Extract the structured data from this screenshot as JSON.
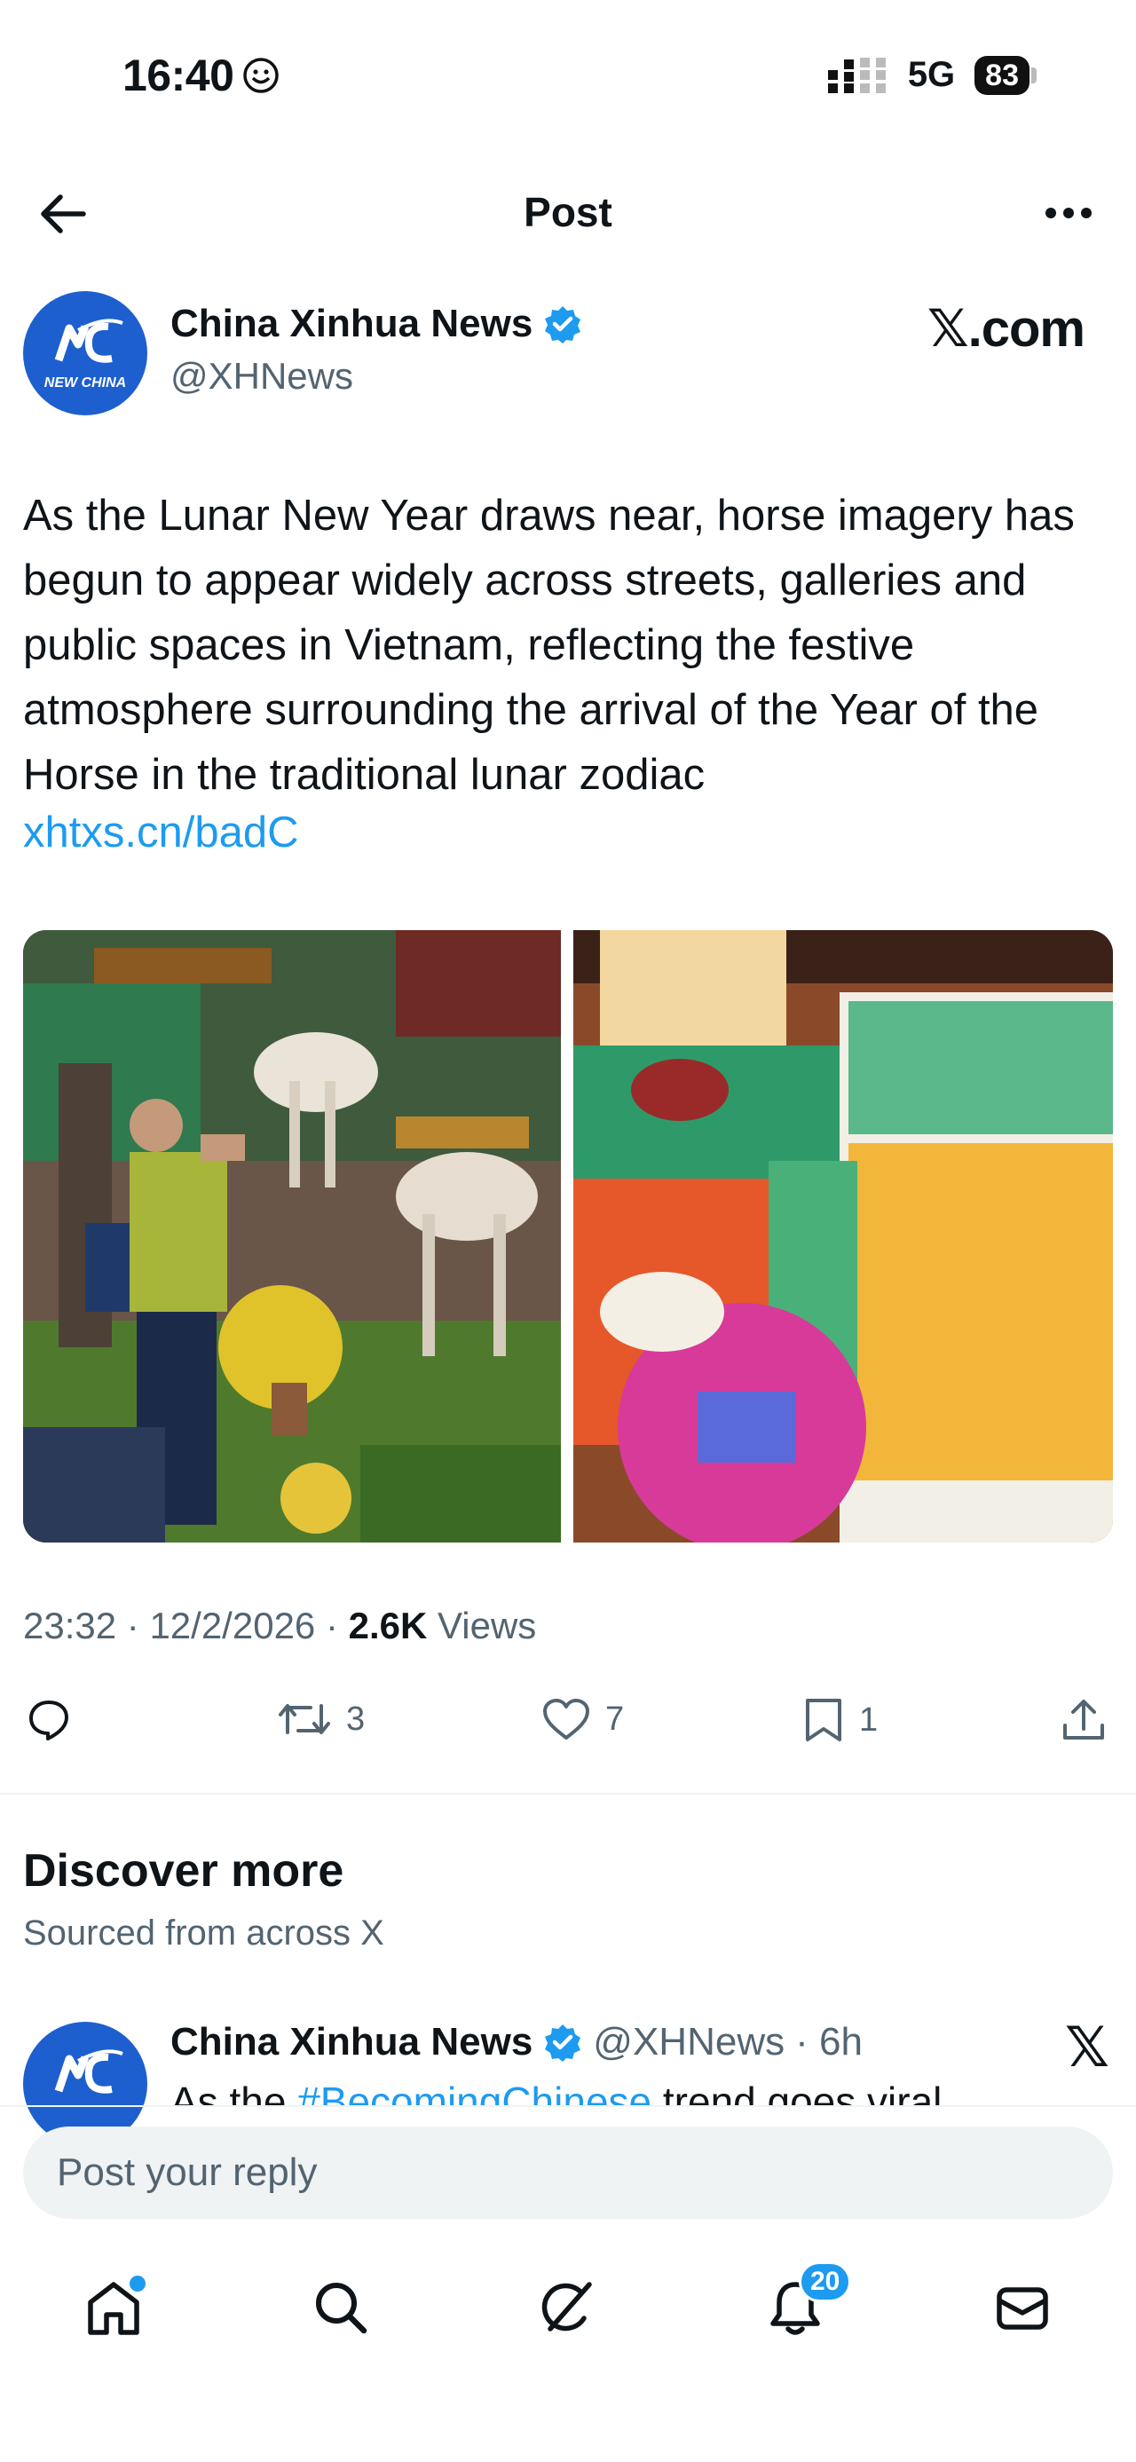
{
  "status_bar": {
    "time": "16:40",
    "network": "5G",
    "battery": "83"
  },
  "header": {
    "title": "Post"
  },
  "author": {
    "name": "China Xinhua News",
    "handle": "@XHNews",
    "avatar_text": "NEW CHINA",
    "source_logo": "𝕏.com"
  },
  "post": {
    "text": "As the Lunar New Year draws near, horse imagery has begun to appear widely across streets, galleries and public spaces in Vietnam, reflecting the festive atmosphere surrounding the arrival of the Year of the Horse in the traditional lunar zodiac",
    "link": "xhtxs.cn/badC"
  },
  "meta": {
    "time": "23:32",
    "date": "12/2/2026",
    "views_count": "2.6K",
    "views_label": "Views"
  },
  "actions": {
    "replies": "",
    "reposts": "3",
    "likes": "7",
    "bookmarks": "1"
  },
  "discover": {
    "title": "Discover more",
    "subtitle": "Sourced from across X",
    "item": {
      "name": "China Xinhua News",
      "handle": "@XHNews",
      "age": "· 6h",
      "text_prefix": "As the ",
      "hashtag": "#BecomingChinese",
      "text_suffix": " trend goes viral"
    }
  },
  "reply": {
    "placeholder": "Post your reply"
  },
  "nav": {
    "notifications_badge": "20"
  },
  "colors": {
    "accent": "#1d9bf0",
    "text": "#0f1419",
    "muted": "#536471",
    "avatar_bg": "#1e5fcf"
  }
}
